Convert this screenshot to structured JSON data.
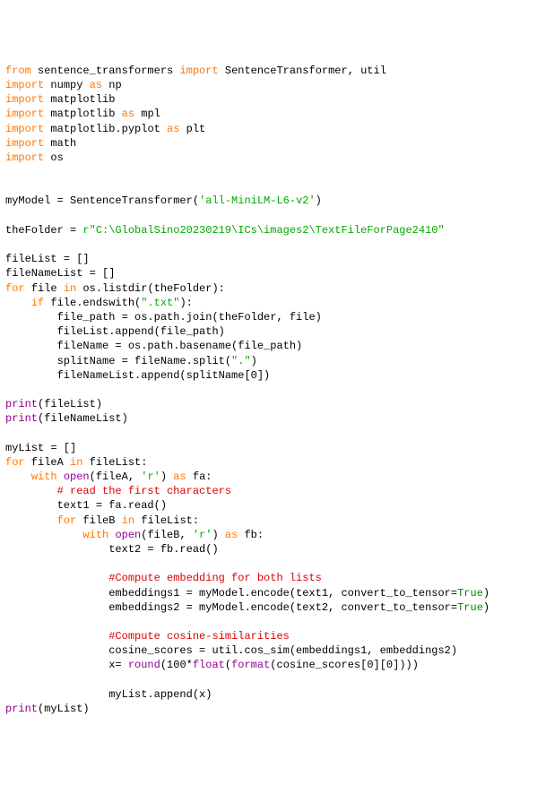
{
  "code": {
    "lines": [
      {
        "seg": [
          {
            "t": "from",
            "c": "k-orange"
          },
          {
            "t": " sentence_transformers "
          },
          {
            "t": "import",
            "c": "k-orange"
          },
          {
            "t": " SentenceTransformer, util"
          }
        ]
      },
      {
        "seg": [
          {
            "t": "import",
            "c": "k-orange"
          },
          {
            "t": " numpy "
          },
          {
            "t": "as",
            "c": "k-orange"
          },
          {
            "t": " np"
          }
        ]
      },
      {
        "seg": [
          {
            "t": "import",
            "c": "k-orange"
          },
          {
            "t": " matplotlib"
          }
        ]
      },
      {
        "seg": [
          {
            "t": "import",
            "c": "k-orange"
          },
          {
            "t": " matplotlib "
          },
          {
            "t": "as",
            "c": "k-orange"
          },
          {
            "t": " mpl"
          }
        ]
      },
      {
        "seg": [
          {
            "t": "import",
            "c": "k-orange"
          },
          {
            "t": " matplotlib.pyplot "
          },
          {
            "t": "as",
            "c": "k-orange"
          },
          {
            "t": " plt"
          }
        ]
      },
      {
        "seg": [
          {
            "t": "import",
            "c": "k-orange"
          },
          {
            "t": " math"
          }
        ]
      },
      {
        "seg": [
          {
            "t": "import",
            "c": "k-orange"
          },
          {
            "t": " os"
          }
        ]
      },
      {
        "seg": [
          {
            "t": ""
          }
        ]
      },
      {
        "seg": [
          {
            "t": ""
          }
        ]
      },
      {
        "seg": [
          {
            "t": "myModel = SentenceTransformer("
          },
          {
            "t": "'all-MiniLM-L6-v2'",
            "c": "s-green"
          },
          {
            "t": ")"
          }
        ]
      },
      {
        "seg": [
          {
            "t": ""
          }
        ]
      },
      {
        "seg": [
          {
            "t": "theFolder = "
          },
          {
            "t": "r\"C:\\GlobalSino20230219\\ICs\\images2\\TextFileForPage2410\"",
            "c": "s-green"
          }
        ]
      },
      {
        "seg": [
          {
            "t": ""
          }
        ]
      },
      {
        "seg": [
          {
            "t": "fileList = []"
          }
        ]
      },
      {
        "seg": [
          {
            "t": "fileNameList = []"
          }
        ]
      },
      {
        "seg": [
          {
            "t": "for",
            "c": "k-orange"
          },
          {
            "t": " file "
          },
          {
            "t": "in",
            "c": "k-orange"
          },
          {
            "t": " os.listdir(theFolder):"
          }
        ]
      },
      {
        "seg": [
          {
            "t": "    "
          },
          {
            "t": "if",
            "c": "k-orange"
          },
          {
            "t": " file.endswith("
          },
          {
            "t": "\".txt\"",
            "c": "s-green"
          },
          {
            "t": "):"
          }
        ]
      },
      {
        "seg": [
          {
            "t": "        file_path = os.path.join(theFolder, file)"
          }
        ]
      },
      {
        "seg": [
          {
            "t": "        fileList.append(file_path)"
          }
        ]
      },
      {
        "seg": [
          {
            "t": "        fileName = os.path.basename(file_path)"
          }
        ]
      },
      {
        "seg": [
          {
            "t": "        splitName = fileName.split("
          },
          {
            "t": "\".\"",
            "c": "s-green"
          },
          {
            "t": ")"
          }
        ]
      },
      {
        "seg": [
          {
            "t": "        fileNameList.append(splitName[0])"
          }
        ]
      },
      {
        "seg": [
          {
            "t": ""
          }
        ]
      },
      {
        "seg": [
          {
            "t": "print",
            "c": "k-purple"
          },
          {
            "t": "(fileList)"
          }
        ]
      },
      {
        "seg": [
          {
            "t": "print",
            "c": "k-purple"
          },
          {
            "t": "(fileNameList)"
          }
        ]
      },
      {
        "seg": [
          {
            "t": ""
          }
        ]
      },
      {
        "seg": [
          {
            "t": "myList = []"
          }
        ]
      },
      {
        "seg": [
          {
            "t": "for",
            "c": "k-orange"
          },
          {
            "t": " fileA "
          },
          {
            "t": "in",
            "c": "k-orange"
          },
          {
            "t": " fileList:"
          }
        ]
      },
      {
        "seg": [
          {
            "t": "    "
          },
          {
            "t": "with",
            "c": "k-orange"
          },
          {
            "t": " "
          },
          {
            "t": "open",
            "c": "k-purple"
          },
          {
            "t": "(fileA, "
          },
          {
            "t": "'r'",
            "c": "s-green"
          },
          {
            "t": ") "
          },
          {
            "t": "as",
            "c": "k-orange"
          },
          {
            "t": " fa:"
          }
        ]
      },
      {
        "seg": [
          {
            "t": "        "
          },
          {
            "t": "# read the first characters",
            "c": "s-red"
          }
        ]
      },
      {
        "seg": [
          {
            "t": "        text1 = fa.read()"
          }
        ]
      },
      {
        "seg": [
          {
            "t": "        "
          },
          {
            "t": "for",
            "c": "k-orange"
          },
          {
            "t": " fileB "
          },
          {
            "t": "in",
            "c": "k-orange"
          },
          {
            "t": " fileList:"
          }
        ]
      },
      {
        "seg": [
          {
            "t": "            "
          },
          {
            "t": "with",
            "c": "k-orange"
          },
          {
            "t": " "
          },
          {
            "t": "open",
            "c": "k-purple"
          },
          {
            "t": "(fileB, "
          },
          {
            "t": "'r'",
            "c": "s-green"
          },
          {
            "t": ") "
          },
          {
            "t": "as",
            "c": "k-orange"
          },
          {
            "t": " fb:"
          }
        ]
      },
      {
        "seg": [
          {
            "t": "                text2 = fb.read()"
          }
        ]
      },
      {
        "seg": [
          {
            "t": ""
          }
        ]
      },
      {
        "seg": [
          {
            "t": "                "
          },
          {
            "t": "#Compute embedding for both lists",
            "c": "s-red"
          }
        ]
      },
      {
        "seg": [
          {
            "t": "                embeddings1 = myModel.encode(text1, convert_to_tensor="
          },
          {
            "t": "True",
            "c": "lit-true"
          },
          {
            "t": ")"
          }
        ]
      },
      {
        "seg": [
          {
            "t": "                embeddings2 = myModel.encode(text2, convert_to_tensor="
          },
          {
            "t": "True",
            "c": "lit-true"
          },
          {
            "t": ")"
          }
        ]
      },
      {
        "seg": [
          {
            "t": ""
          }
        ]
      },
      {
        "seg": [
          {
            "t": "                "
          },
          {
            "t": "#Compute cosine-similarities",
            "c": "s-red"
          }
        ]
      },
      {
        "seg": [
          {
            "t": "                cosine_scores = util.cos_sim(embeddings1, embeddings2)"
          }
        ]
      },
      {
        "seg": [
          {
            "t": "                x= "
          },
          {
            "t": "round",
            "c": "k-purple"
          },
          {
            "t": "(100*"
          },
          {
            "t": "float",
            "c": "k-purple"
          },
          {
            "t": "("
          },
          {
            "t": "format",
            "c": "k-purple"
          },
          {
            "t": "(cosine_scores[0][0])))"
          }
        ]
      },
      {
        "seg": [
          {
            "t": ""
          }
        ]
      },
      {
        "seg": [
          {
            "t": "                myList.append(x)"
          }
        ]
      },
      {
        "seg": [
          {
            "t": "print",
            "c": "k-purple"
          },
          {
            "t": "(myList)"
          }
        ]
      }
    ]
  }
}
